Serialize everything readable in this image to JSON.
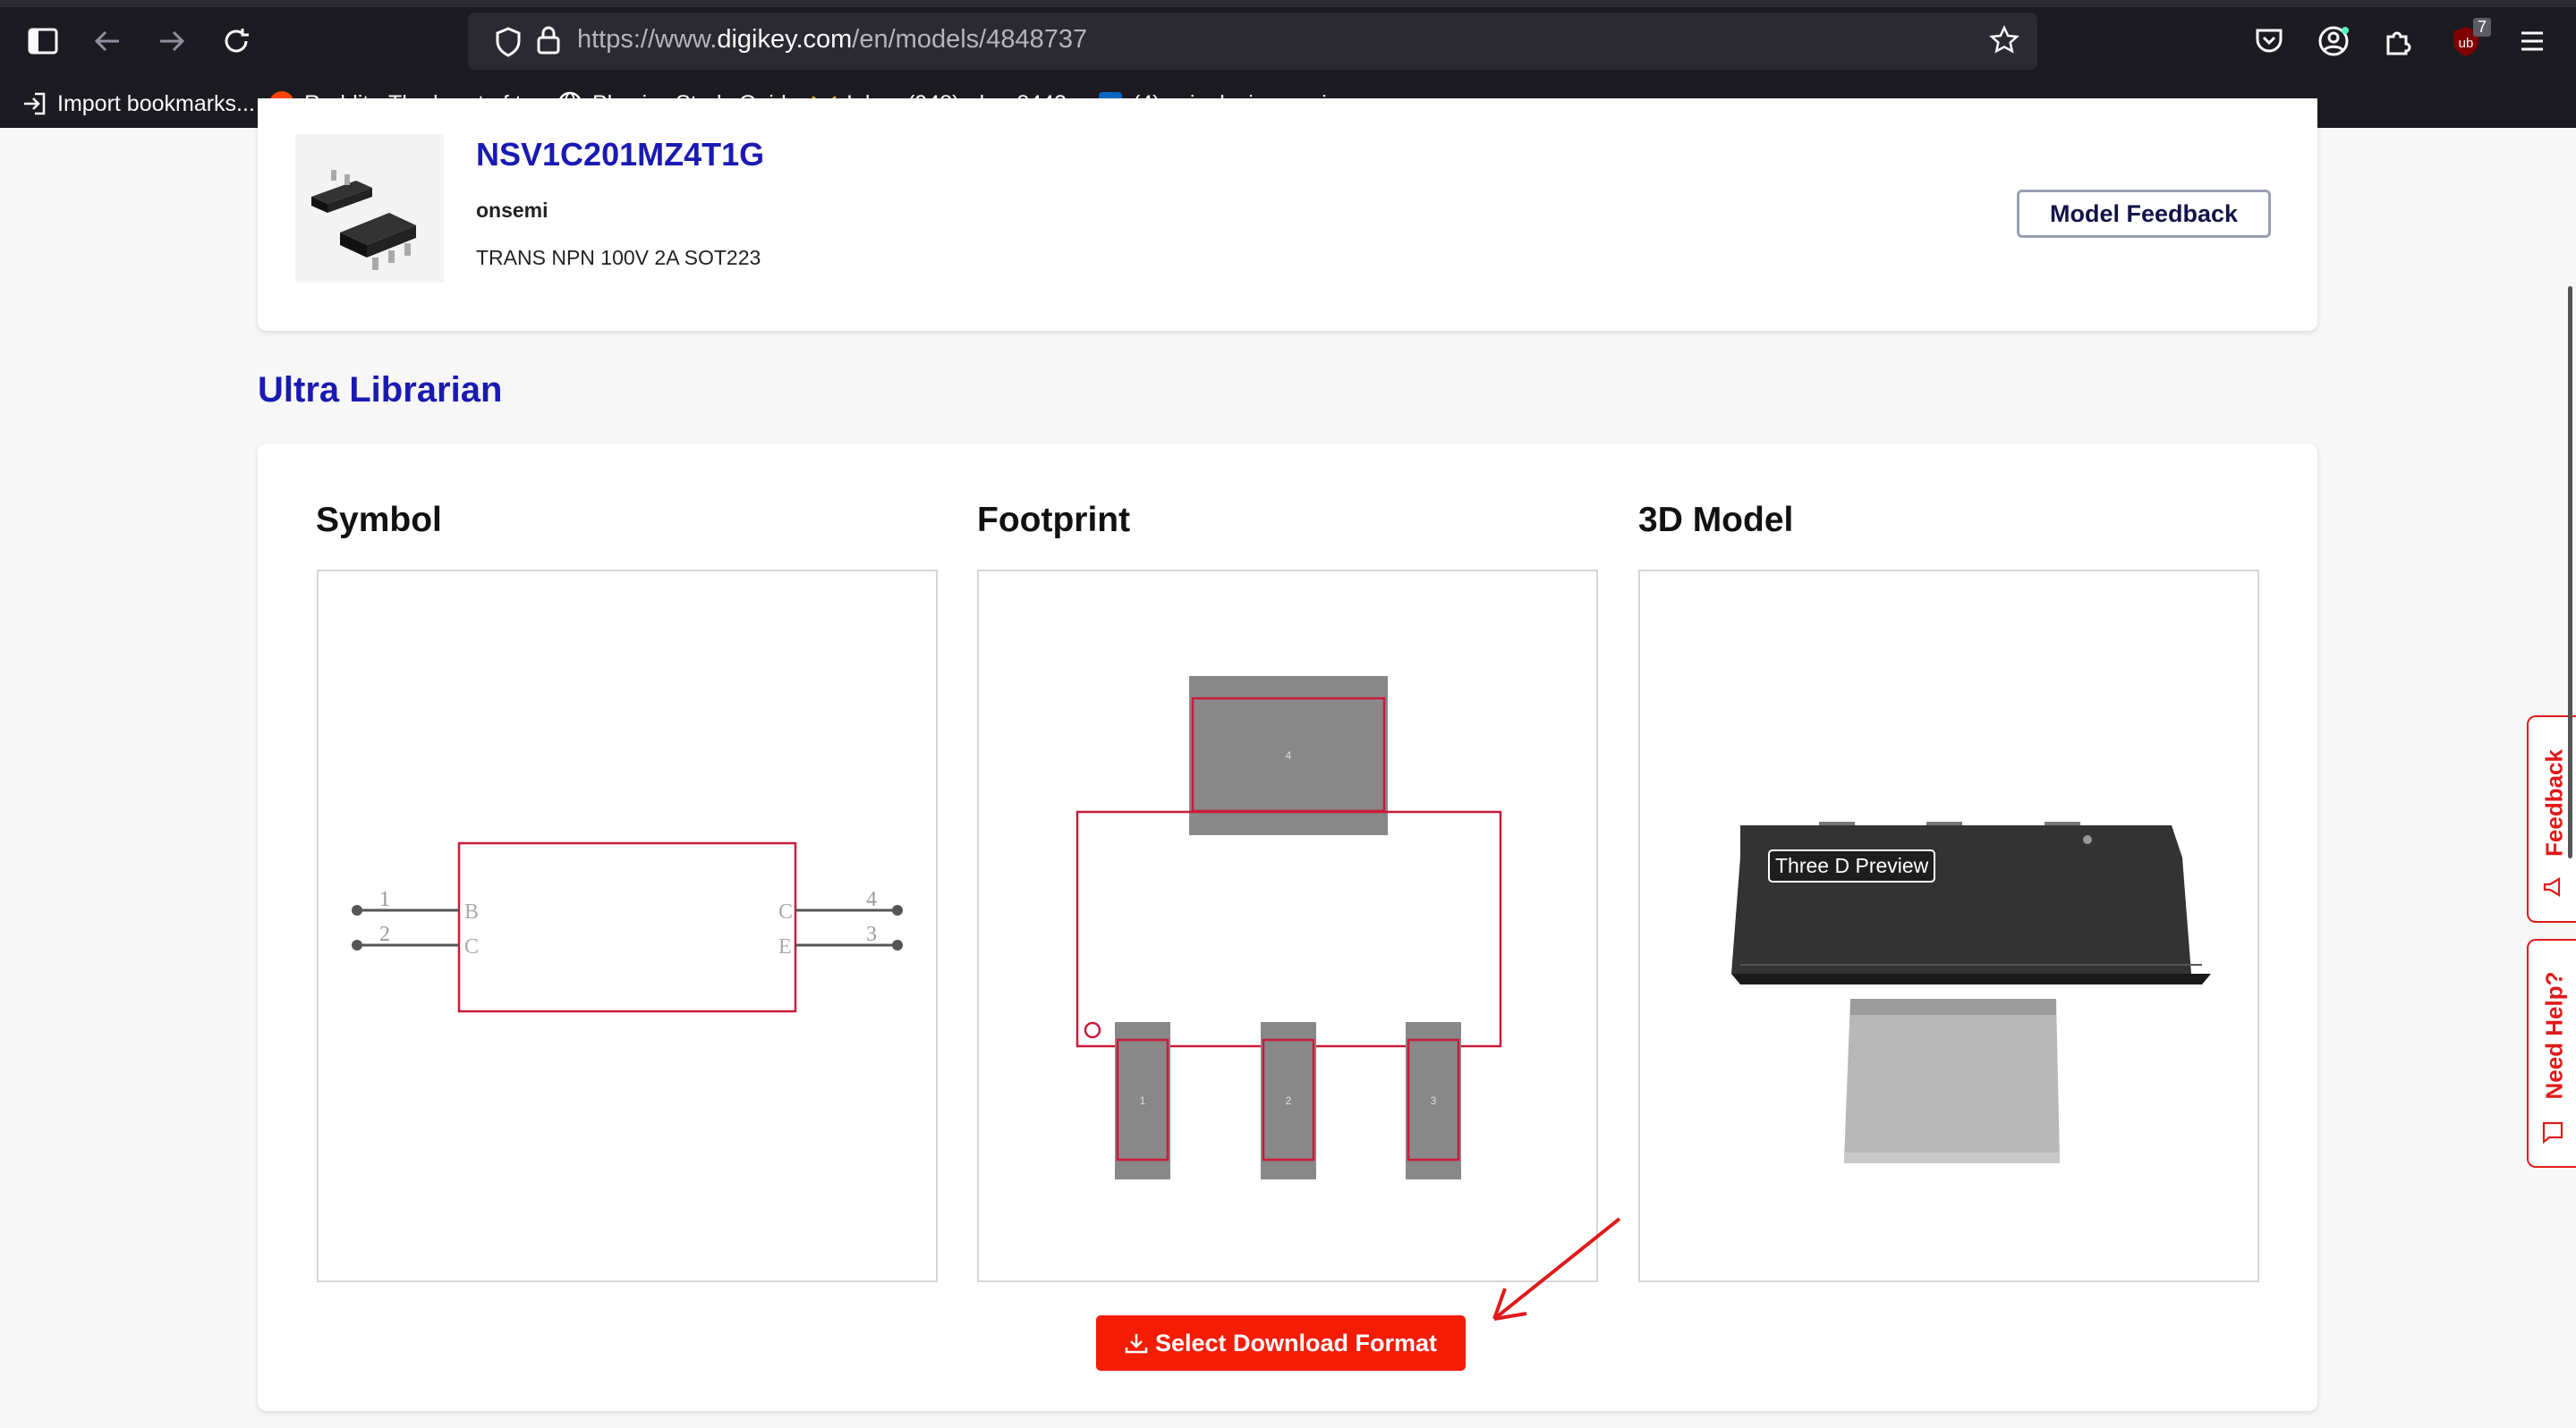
{
  "browser": {
    "url_prefix": "https://www.",
    "url_host": "digikey.com",
    "url_path": "/en/models/4848737",
    "extension_badge": "7",
    "bookmarks": [
      {
        "label": "Import bookmarks...",
        "icon": "import-icon"
      },
      {
        "label": "Reddit - The heart of t...",
        "icon": "reddit-icon"
      },
      {
        "label": "Physics Study Guides",
        "icon": "globe-icon"
      },
      {
        "label": "Inbox (948) - bee8443...",
        "icon": "gmail-icon"
      },
      {
        "label": "(4) asic design engine...",
        "icon": "linkedin-icon"
      }
    ]
  },
  "part": {
    "number": "NSV1C201MZ4T1G",
    "manufacturer": "onsemi",
    "description": "TRANS NPN 100V 2A SOT223",
    "feedback_label": "Model Feedback"
  },
  "section": {
    "title": "Ultra Librarian",
    "columns": [
      "Symbol",
      "Footprint",
      "3D Model"
    ],
    "symbol": {
      "left_pins": [
        {
          "num": "1",
          "name": "B"
        },
        {
          "num": "2",
          "name": "C"
        }
      ],
      "right_pins": [
        {
          "num": "4",
          "name": "C"
        },
        {
          "num": "3",
          "name": "E"
        }
      ]
    },
    "footprint": {
      "pads": [
        "4",
        "1",
        "2",
        "3"
      ]
    },
    "preview_label": "Three D Preview",
    "download_label": "Select Download Format"
  },
  "side_tabs": {
    "feedback": "Feedback",
    "help": "Need Help?"
  },
  "colors": {
    "brand_red": "#f41c05",
    "title_blue": "#1a1ab3",
    "symbol_red": "#cc1a3a"
  }
}
